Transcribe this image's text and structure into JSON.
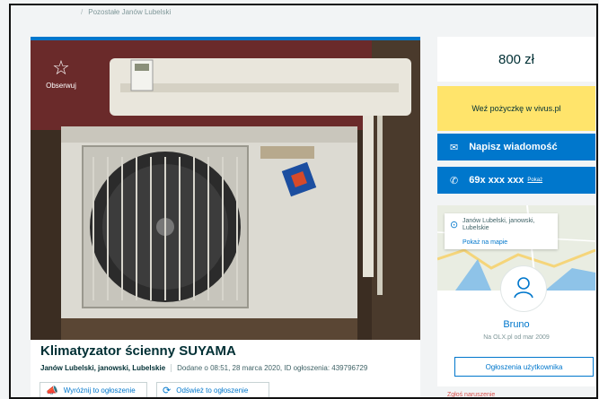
{
  "breadcrumb": {
    "current": "Pozostałe Janów Lubelski"
  },
  "gallery": {
    "observe_label": "Obserwuj"
  },
  "listing": {
    "title": "Klimatyzator ścienny SUYAMA",
    "location": "Janów Lubelski, janowski, Lubelskie",
    "added": "Dodane o 08:51, 28 marca 2020, ID ogłoszenia: 439796729",
    "promote_label": "Wyróżnij to ogłoszenie",
    "refresh_label": "Odśwież to ogłoszenie"
  },
  "sidebar": {
    "price": "800 zł",
    "loan_label": "Weź pożyczkę w vivus.pl",
    "message_label": "Napisz wiadomość",
    "phone": "69x xxx xxx",
    "phone_show": "Pokaż",
    "map": {
      "address": "Janów Lubelski, janowski, Lubelskie",
      "show_on_map": "Pokaż na mapie"
    },
    "seller": {
      "name": "Bruno",
      "since": "Na OLX.pl od mar 2009",
      "ads_label": "Ogłoszenia użytkownika"
    },
    "report_label": "Zgłoś naruszenie"
  },
  "colors": {
    "accent": "#0077cc",
    "loan_bg": "#ffe46b",
    "text_dark": "#002f34"
  }
}
